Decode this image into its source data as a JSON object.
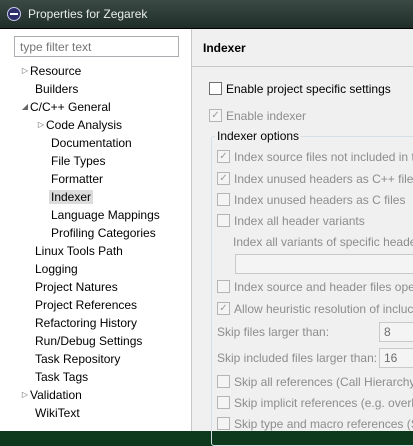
{
  "window": {
    "title": "Properties for Zegarek"
  },
  "filter": {
    "placeholder": "type filter text"
  },
  "tree": {
    "resource": "Resource",
    "builders": "Builders",
    "cpp_general": "C/C++ General",
    "code_analysis": "Code Analysis",
    "documentation": "Documentation",
    "file_types": "File Types",
    "formatter": "Formatter",
    "indexer": "Indexer",
    "language_mappings": "Language Mappings",
    "profiling_categories": "Profiling Categories",
    "linux_tools_path": "Linux Tools Path",
    "logging": "Logging",
    "project_natures": "Project Natures",
    "project_references": "Project References",
    "refactoring_history": "Refactoring History",
    "run_debug_settings": "Run/Debug Settings",
    "task_repository": "Task Repository",
    "task_tags": "Task Tags",
    "validation": "Validation",
    "wikitext": "WikiText"
  },
  "page": {
    "title": "Indexer",
    "enable_project_specific": "Enable project specific settings",
    "enable_indexer": "Enable indexer",
    "indexer_options": "Indexer options",
    "opt_index_source_not_included": "Index source files not included in t",
    "opt_index_unused_cpp": "Index unused headers as C++ files",
    "opt_index_unused_c": "Index unused headers as C files",
    "opt_index_all_variants": "Index all header variants",
    "index_all_variants_specific": "Index all variants of specific heade",
    "opt_index_source_open": "Index source and header files oper",
    "opt_allow_heuristic": "Allow heuristic resolution of incluc",
    "skip_files_larger": "Skip files larger than:",
    "skip_files_larger_value": "8",
    "skip_included_larger": "Skip included files larger than:",
    "skip_included_larger_value": "16",
    "opt_skip_all_refs": "Skip all references (Call Hierarchy a",
    "opt_skip_implicit_refs": "Skip implicit references (e.g. overlo",
    "opt_skip_type_macro_refs": "Skip type and macro references (Se"
  }
}
